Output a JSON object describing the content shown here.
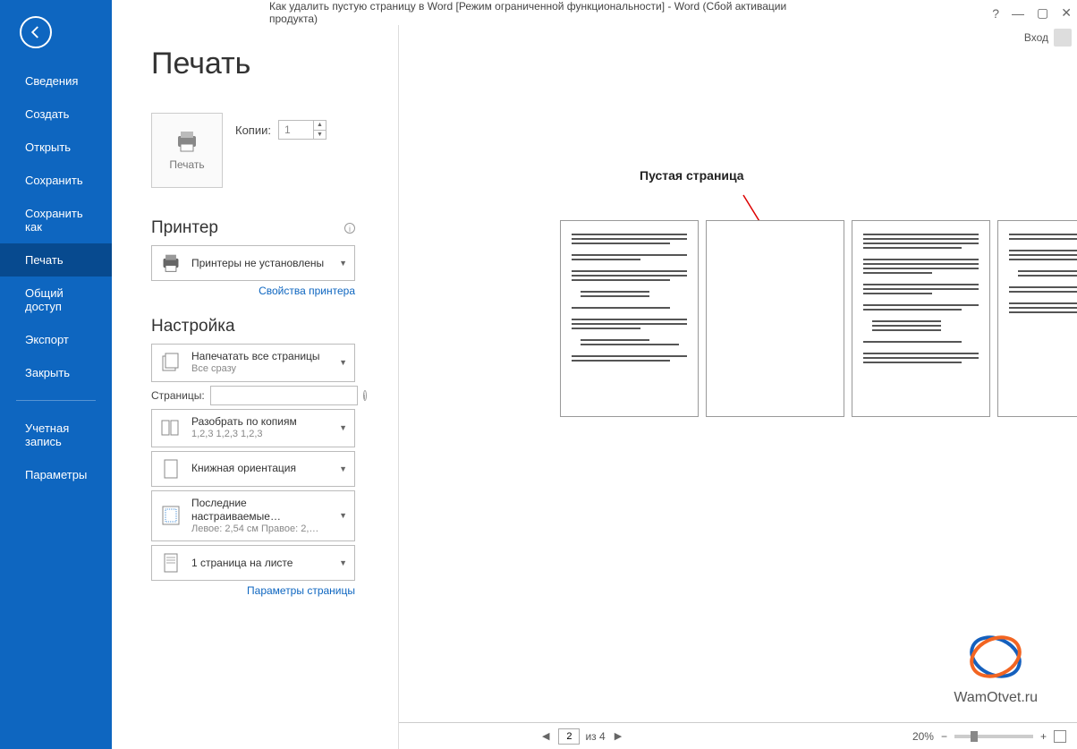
{
  "title": "Как удалить пустую страницу в Word [Режим ограниченной функциональности] - Word (Сбой активации продукта)",
  "signin": "Вход",
  "sidebar": {
    "items": [
      {
        "label": "Сведения"
      },
      {
        "label": "Создать"
      },
      {
        "label": "Открыть"
      },
      {
        "label": "Сохранить"
      },
      {
        "label": "Сохранить как"
      },
      {
        "label": "Печать"
      },
      {
        "label": "Общий доступ"
      },
      {
        "label": "Экспорт"
      },
      {
        "label": "Закрыть"
      }
    ],
    "account": "Учетная\nзапись",
    "options": "Параметры"
  },
  "page_title": "Печать",
  "print_button": "Печать",
  "copies_label": "Копии:",
  "copies_value": "1",
  "printer_head": "Принтер",
  "printer_dd": "Принтеры не установлены",
  "printer_props": "Свойства принтера",
  "settings_head": "Настройка",
  "print_all": {
    "title": "Напечатать все страницы",
    "sub": "Все сразу"
  },
  "pages_label": "Страницы:",
  "pages_value": "",
  "collate": {
    "title": "Разобрать по копиям",
    "sub": "1,2,3    1,2,3    1,2,3"
  },
  "orientation": "Книжная ориентация",
  "margins": {
    "title": "Последние настраиваемые…",
    "sub": "Левое:  2,54 см    Правое:  2,…"
  },
  "per_sheet": "1 страница на листе",
  "page_setup": "Параметры страницы",
  "preview_label": "Пустая страница",
  "watermark": "WamOtvet.ru",
  "nav": {
    "current": "2",
    "total": "из 4",
    "zoom": "20%"
  }
}
